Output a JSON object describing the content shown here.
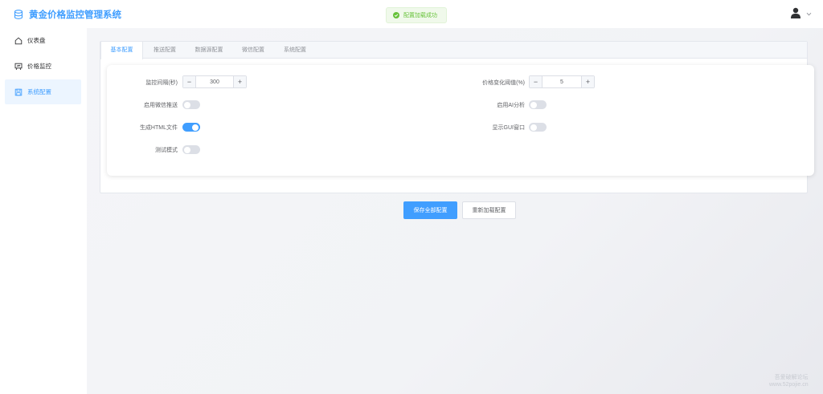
{
  "header": {
    "title": "黄金价格监控管理系统",
    "toast": "配置加载成功"
  },
  "sidebar": {
    "items": [
      {
        "label": "仪表盘",
        "icon": "home-icon"
      },
      {
        "label": "价格监控",
        "icon": "monitor-icon"
      },
      {
        "label": "系统配置",
        "icon": "save-icon",
        "active": true
      }
    ]
  },
  "tabs": [
    "基本配置",
    "推送配置",
    "数据源配置",
    "微信配置",
    "系统配置"
  ],
  "form": {
    "monitor_interval": {
      "label": "监控间隔(秒)",
      "value": "300"
    },
    "price_threshold": {
      "label": "价格变化阈值(%)",
      "value": "5"
    },
    "wechat_push": {
      "label": "启用微信推送",
      "on": false
    },
    "ai_analysis": {
      "label": "启用AI分析",
      "on": false
    },
    "html_file": {
      "label": "生成HTML文件",
      "on": true
    },
    "gui_window": {
      "label": "显示GUI窗口",
      "on": false
    },
    "test_mode": {
      "label": "测试模式",
      "on": false
    }
  },
  "actions": {
    "save_all": "保存全部配置",
    "reload": "重新加载配置"
  },
  "watermark": {
    "line1": "吾爱破解论坛",
    "line2": "www.52pojie.cn"
  },
  "colors": {
    "primary": "#409eff",
    "success": "#67c23a"
  }
}
